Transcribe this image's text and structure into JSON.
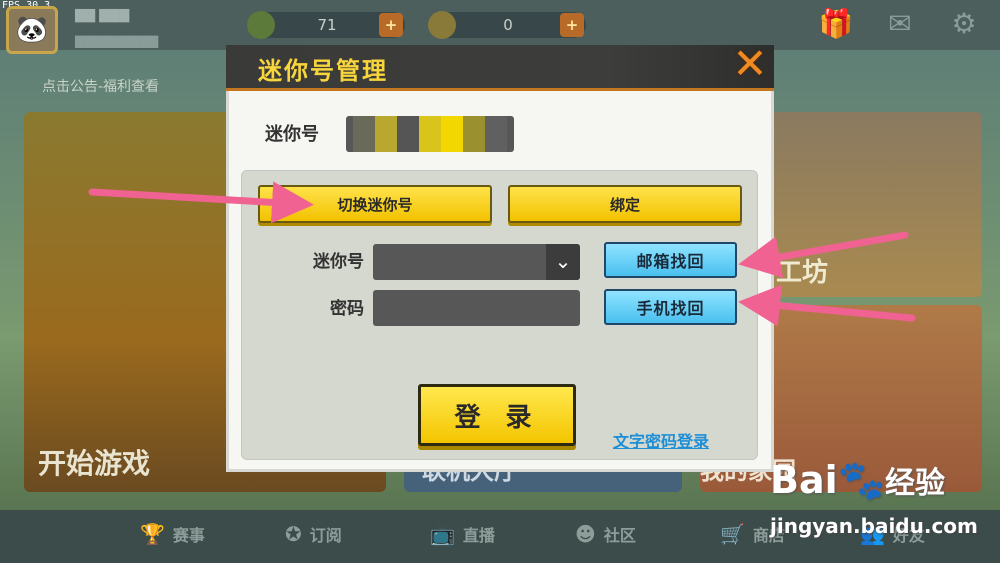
{
  "fps": "FPS 30.3",
  "header": {
    "beans": "71",
    "coins": "0"
  },
  "notice": "点击公告-福利查看",
  "panels": {
    "start_game": "开始游戏",
    "online_hall": "联机大厅",
    "workshop": "工坊",
    "my_home": "我的家园"
  },
  "bottom_nav": [
    "赛事",
    "订阅",
    "直播",
    "社区",
    "商店",
    "好友"
  ],
  "dialog": {
    "title": "迷你号管理",
    "close": "✕",
    "mini_id_label": "迷你号",
    "switch_button": "切换迷你号",
    "bind_button": "绑定",
    "account_label": "迷你号",
    "password_label": "密码",
    "email_recover": "邮箱找回",
    "phone_recover": "手机找回",
    "login_button": "登 录",
    "text_password_login": "文字密码登录",
    "dropdown_icon": "chevron-down-icon"
  },
  "watermark": {
    "brand": "Bai",
    "brand_suffix": "经验",
    "url": "jingyan.baidu.com"
  },
  "colors": {
    "dialog_title": "#f7d53b",
    "yellow_button": "#f2c200",
    "blue_button": "#49c0ef",
    "link": "#1e8fd6",
    "arrow": "#f06292"
  }
}
